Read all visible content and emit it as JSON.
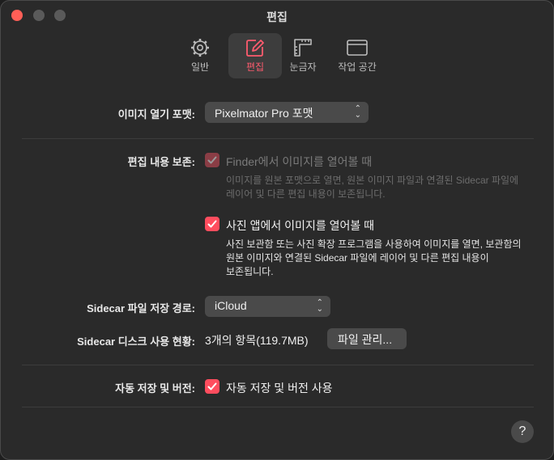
{
  "window": {
    "title": "편집"
  },
  "toolbar": {
    "items": [
      {
        "label": "일반",
        "icon": "gear-icon"
      },
      {
        "label": "편집",
        "icon": "pencil-square-icon",
        "selected": true
      },
      {
        "label": "눈금자",
        "icon": "ruler-icon"
      },
      {
        "label": "작업 공간",
        "icon": "window-icon"
      }
    ]
  },
  "image_open_format": {
    "label": "이미지 열기 포맷:",
    "selected": "Pixelmator Pro 포맷"
  },
  "preserve_edits": {
    "label": "편집 내용 보존:",
    "finder": {
      "text": "Finder에서 이미지를 열어볼 때",
      "checked": true,
      "enabled": false,
      "desc_line1": "이미지를 원본 포맷으로 열면, 원본 이미지 파일과 연결된 Sidecar 파일에",
      "desc_line2": "레이어 및 다른 편집 내용이 보존됩니다."
    },
    "photos": {
      "text": "사진 앱에서 이미지를 열어볼 때",
      "checked": true,
      "enabled": true,
      "desc_line1": "사진 보관함 또는 사진 확장 프로그램을 사용하여 이미지를 열면, 보관함의",
      "desc_line2": "원본 이미지와 연결된 Sidecar 파일에 레이어 및 다른 편집 내용이",
      "desc_line3": "보존됩니다."
    }
  },
  "sidecar_location": {
    "label": "Sidecar 파일 저장 경로:",
    "selected": "iCloud"
  },
  "sidecar_disk": {
    "label": "Sidecar 디스크 사용 현황:",
    "value": "3개의 항목(119.7MB)",
    "button": "파일 관리..."
  },
  "autosave": {
    "label": "자동 저장 및 버전:",
    "text": "자동 저장 및 버전 사용",
    "checked": true
  },
  "help": {
    "label": "?"
  },
  "colors": {
    "accent": "#ff4d5e",
    "background": "#2a2a2a",
    "control": "#4a4a4a"
  }
}
